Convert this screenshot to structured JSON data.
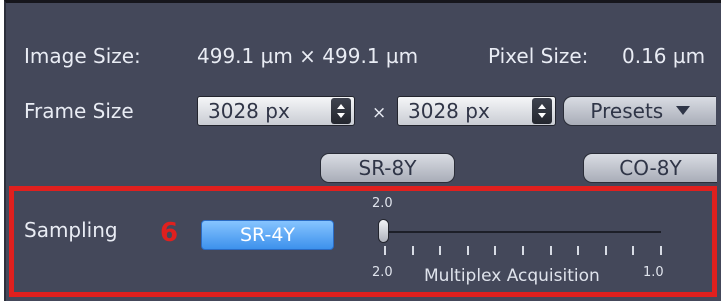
{
  "image_size": {
    "label": "Image Size:",
    "value": "499.1 µm × 499.1 µm"
  },
  "pixel_size": {
    "label": "Pixel Size:",
    "value": "0.16 µm"
  },
  "frame_size": {
    "label": "Frame Size",
    "width_value": "3028 px",
    "separator": "×",
    "height_value": "3028 px",
    "presets_label": "Presets",
    "presets_icon": "triangle-down-icon"
  },
  "mode_buttons": {
    "sr8y": "SR-8Y",
    "co8y": "CO-8Y"
  },
  "sampling": {
    "label": "Sampling",
    "annotation_number": "6",
    "button_label": "SR-4Y",
    "slider": {
      "top_value": "2.0",
      "min_label": "2.0",
      "max_label": "1.0",
      "caption": "Multiplex Acquisition",
      "current_value": 2.0
    }
  },
  "colors": {
    "panel_bg": "#44485a",
    "highlight_border": "#e0201e",
    "active_button": "#4a9cf0",
    "annotation_text": "#e0201e"
  }
}
